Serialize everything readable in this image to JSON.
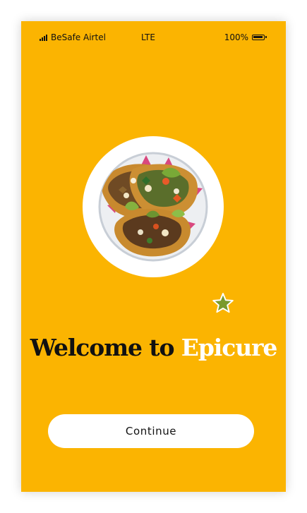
{
  "status_bar": {
    "carrier": "BeSafe Airtel",
    "network": "LTE",
    "battery": "100%"
  },
  "welcome": {
    "prefix": "Welcome to",
    "brand": "Epicure"
  },
  "actions": {
    "continue_label": "Continue"
  },
  "colors": {
    "background": "#FBB401",
    "brand_text": "#FFFFFF",
    "primary_text": "#111111",
    "button_background": "#FFFFFF",
    "star_fill": "#7A9A2C"
  },
  "icons": {
    "signal": "signal-icon",
    "battery": "battery-icon",
    "star": "star-icon"
  }
}
